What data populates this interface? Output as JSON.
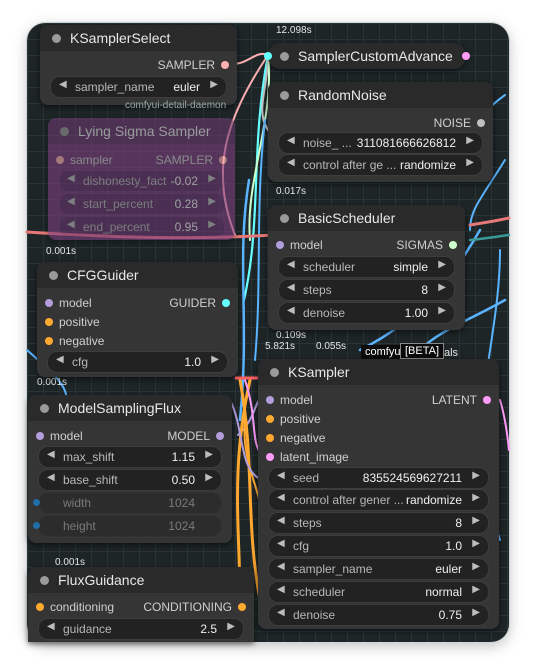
{
  "colors": {
    "canvas": "#1d2527",
    "node": "#353535",
    "accent_model": "#b39ddb",
    "accent_cond": "#ffa931",
    "accent_latent": "#ff9cf9",
    "accent_sampler": "#ffb0b0",
    "accent_noise": "#c0c0c0",
    "accent_sigmas": "#cdffcd",
    "accent_guider": "#66ffff"
  },
  "timings": {
    "t1": "12.098s",
    "t2": "0.017s",
    "t3": "0.001s",
    "t4": "0.001s",
    "t5": "0.109s",
    "t6": "5.821s",
    "t7": "0.055s",
    "t8": "0.001s"
  },
  "ksampler_select": {
    "title": "KSamplerSelect",
    "out": "SAMPLER",
    "sampler_name_label": "sampler_name",
    "sampler_name_value": "euler"
  },
  "detail_daemon_label": "comfyui-detail-daemon",
  "lying_sigma": {
    "title": "Lying Sigma Sampler",
    "in_sampler": "sampler",
    "out_sampler": "SAMPLER",
    "w1_label": "dishonesty_fact",
    "w1_value": "-0.02",
    "w2_label": "start_percent",
    "w2_value": "0.28",
    "w3_label": "end_percent",
    "w3_value": "0.95"
  },
  "sampler_custom_advance": {
    "title": "SamplerCustomAdvance"
  },
  "random_noise": {
    "title": "RandomNoise",
    "out": "NOISE",
    "seed_label": "noise_ ...",
    "seed_value": "311081666626812",
    "cag_label": "control after ge ...",
    "cag_value": "randomize"
  },
  "basic_scheduler": {
    "title": "BasicScheduler",
    "in_model": "model",
    "out": "SIGMAS",
    "scheduler_label": "scheduler",
    "scheduler_value": "simple",
    "steps_label": "steps",
    "steps_value": "8",
    "denoise_label": "denoise",
    "denoise_value": "1.00"
  },
  "cfg_guider": {
    "title": "CFGGuider",
    "in_model": "model",
    "in_positive": "positive",
    "in_negative": "negative",
    "out": "GUIDER",
    "cfg_label": "cfg",
    "cfg_value": "1.0"
  },
  "comfy_badge": "comfyui",
  "beta_badge": "[BETA]",
  "beta_suffix": "als",
  "model_sampling_flux": {
    "title": "ModelSamplingFlux",
    "in_model": "model",
    "out": "MODEL",
    "max_shift_label": "max_shift",
    "max_shift_value": "1.15",
    "base_shift_label": "base_shift",
    "base_shift_value": "0.50",
    "width_label": "width",
    "width_value": "1024",
    "height_label": "height",
    "height_value": "1024"
  },
  "ksampler": {
    "title": "KSampler",
    "in_model": "model",
    "in_positive": "positive",
    "in_negative": "negative",
    "in_latent": "latent_image",
    "out": "LATENT",
    "seed_label": "seed",
    "seed_value": "835524569627211",
    "cag_label": "control after gener ...",
    "cag_value": "randomize",
    "steps_label": "steps",
    "steps_value": "8",
    "cfg_label": "cfg",
    "cfg_value": "1.0",
    "sampler_label": "sampler_name",
    "sampler_value": "euler",
    "scheduler_label": "scheduler",
    "scheduler_value": "normal",
    "denoise_label": "denoise",
    "denoise_value": "0.75"
  },
  "flux_guidance": {
    "title": "FluxGuidance",
    "in": "conditioning",
    "out": "CONDITIONING",
    "guidance_label": "guidance",
    "guidance_value": "2.5"
  }
}
